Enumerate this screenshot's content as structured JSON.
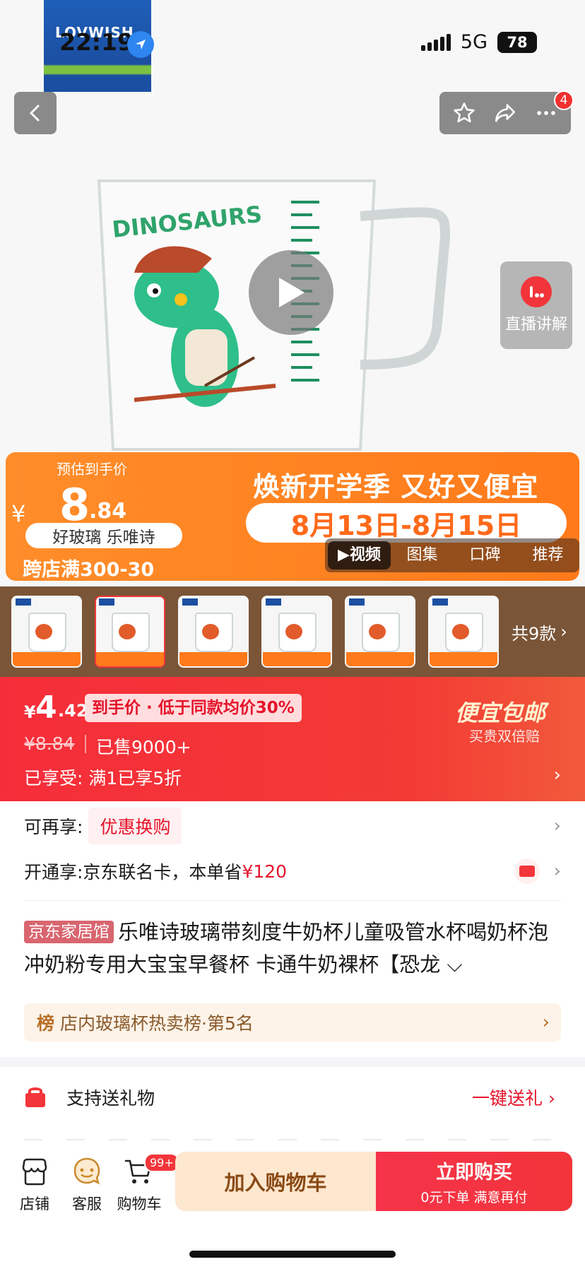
{
  "status_bar": {
    "time": "22:19",
    "network": "5G",
    "battery": "78"
  },
  "brand_logo_text": "LOVWISH",
  "header": {
    "notification_count": "4"
  },
  "live": {
    "label": "直播讲解"
  },
  "promo": {
    "estimated_label": "预估到手价",
    "currency": "¥",
    "price_int": "8",
    "price_dec": ".84",
    "tags": "好玻璃 乐唯诗",
    "cross_store": "跨店满300-30",
    "slogan": "焕新开学季 又好又便宜",
    "date_range": "8月13日-8月15日",
    "media_tabs": [
      "▶视频",
      "图集",
      "口碑",
      "推荐"
    ]
  },
  "variants": {
    "count_label": "共9款",
    "selected_index": 1,
    "thumb_count": 6
  },
  "price_banner": {
    "currency": "¥",
    "price_int": "4",
    "price_dec": ".42",
    "tag": "到手价 · 低于同款均价30%",
    "original_price": "¥8.84",
    "sold": "已售9000+",
    "enjoyed": "已享受: 满1已享5折",
    "cheap_ship": "便宜包邮",
    "cheap_ship_sub": "买贵双倍赔"
  },
  "rows": {
    "again_label": "可再享:",
    "again_pill": "优惠换购",
    "card_label": "开通享:京东联名卡，本单省",
    "card_amount": "¥120"
  },
  "product": {
    "store_tag": "京东家居馆",
    "title": "乐唯诗玻璃带刻度牛奶杯儿童吸管水杯喝奶杯泡冲奶粉专用大宝宝早餐杯 卡通牛奶裸杯【恐龙"
  },
  "rank": {
    "icon_text": "榜",
    "text": "店内玻璃杯热卖榜·第5名"
  },
  "gift": {
    "label": "支持送礼物",
    "link": "一键送礼"
  },
  "bottom_bar": {
    "store": "店铺",
    "service": "客服",
    "cart": "购物车",
    "cart_badge": "99+",
    "add_to_cart": "加入购物车",
    "buy_now": "立即购买",
    "buy_now_sub": "0元下单 满意再付"
  },
  "colors": {
    "accent_red": "#f2353a",
    "promo_orange": "#ff7a1a"
  }
}
